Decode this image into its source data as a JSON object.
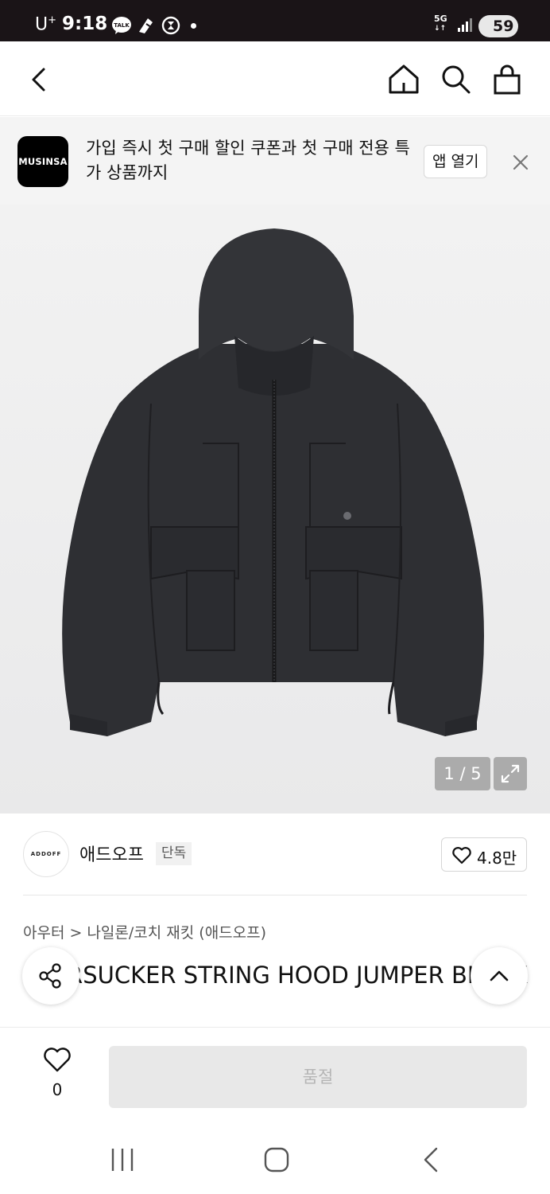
{
  "status_bar": {
    "carrier": "U",
    "carrier_sup": "+",
    "time": "9:18",
    "network": "5G",
    "battery": "59"
  },
  "top_nav": {
    "icons": [
      "back-icon",
      "home-icon",
      "search-icon",
      "shopping-bag-icon"
    ]
  },
  "promo": {
    "logo_text": "MUSINSA",
    "message": "가입 즉시 첫 구매 할인 쿠폰과 첫 구매 전용 특가 상품까지",
    "open_app_label": "앱 열기"
  },
  "gallery": {
    "counter": "1 / 5",
    "current": 1,
    "total": 5
  },
  "brand": {
    "logo_text": "ADDOFF",
    "name": "애드오프",
    "badge": "단독",
    "like_count": "4.8만"
  },
  "product": {
    "category": "아우터 > 나일론/코치 재킷 (애드오프)",
    "title": "SEERSUCKER STRING HOOD JUMPER BLACK"
  },
  "bottom_bar": {
    "wish_count": "0",
    "soldout_label": "품절"
  },
  "colors": {
    "accent_dark": "#000000",
    "soldout_bg": "#e8e8e8",
    "soldout_text": "#b5b5b5"
  }
}
